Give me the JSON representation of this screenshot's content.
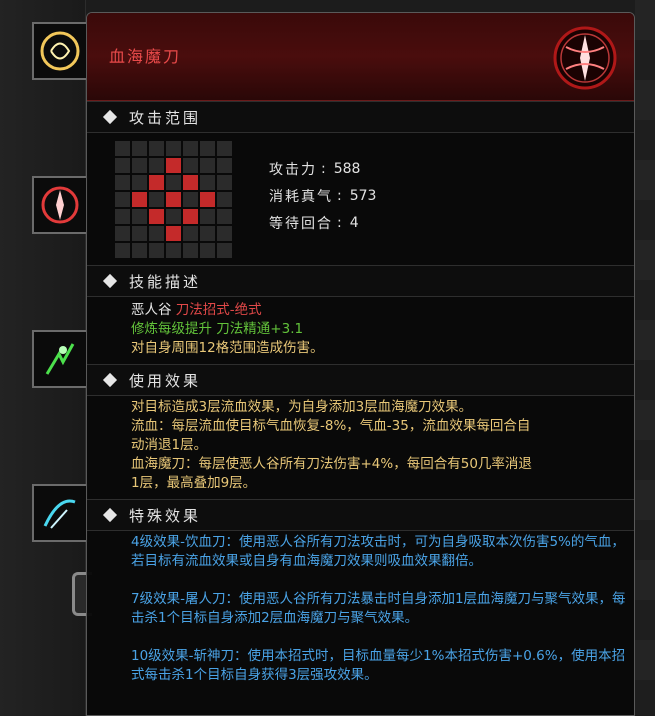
{
  "tooltip": {
    "title": "血海魔刀",
    "sections": {
      "range": "攻击范围",
      "skill_desc": "技能描述",
      "use_effect": "使用效果",
      "special_effect": "特殊效果"
    },
    "grid_active": [
      10,
      16,
      18,
      22,
      24,
      26,
      30,
      32,
      38
    ],
    "stats": [
      {
        "label": "攻击力",
        "value": "588"
      },
      {
        "label": "消耗真气",
        "value": "573"
      },
      {
        "label": "等待回合",
        "value": "4"
      }
    ],
    "skill_desc": {
      "line1_prefix": "恶人谷",
      "line1_tag": "刀法招式-绝式",
      "line2": "修炼每级提升 刀法精通+3.1",
      "line3": "对自身周围12格范围造成伤害。"
    },
    "use_effect": {
      "line1": "对目标造成3层流血效果，为自身添加3层血海魔刀效果。",
      "line2": "流血：每层流血使目标气血恢复-8%，气血-35，流血效果每回合自",
      "line3": "动消退1层。",
      "line4": "血海魔刀：每层使恶人谷所有刀法伤害+4%，每回合有50几率消退",
      "line5": "1层，最高叠加9层。"
    },
    "special_effect": {
      "p1": "4级效果-饮血刀：使用恶人谷所有刀法攻击时，可为自身吸取本次伤害5%的气血，若目标有流血效果或自身有血海魔刀效果则吸血效果翻倍。",
      "p2": "7级效果-屠人刀：使用恶人谷所有刀法暴击时自身添加1层血海魔刀与聚气效果，每击杀1个目标自身添加2层血海魔刀与聚气效果。",
      "p3": "10级效果-斩神刀：使用本招式时，目标血量每少1%本招式伤害+0.6%，使用本招式每击杀1个目标自身获得3层强攻效果。"
    }
  },
  "colors": {
    "title_red": "#e84a4a",
    "tag_red": "#e04848",
    "green": "#62c23a",
    "yellow": "#e8c778",
    "blue": "#4aa3e6"
  },
  "icons": {
    "skill_icon": "blood-demon-blade-icon",
    "section_marker": "diamond-icon"
  }
}
